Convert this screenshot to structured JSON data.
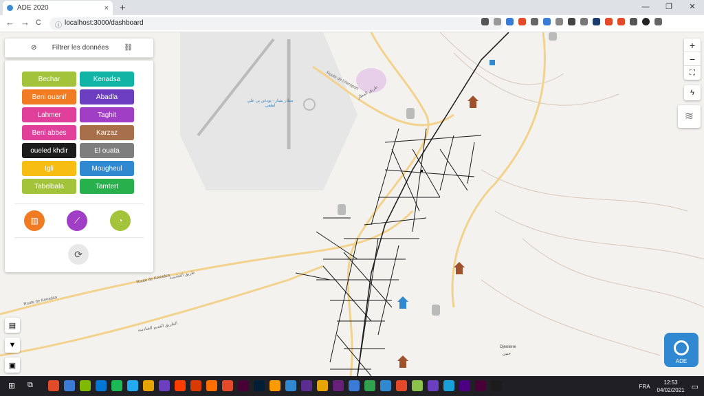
{
  "browser": {
    "tab_title": "ADE 2020",
    "tab_close": "×",
    "new_tab": "+",
    "win_min": "—",
    "win_max": "❐",
    "win_close": "✕",
    "back": "←",
    "forward": "→",
    "reload": "C",
    "url": "localhost:3000/dashboard"
  },
  "panel": {
    "title": "Filtrer les données",
    "cities": [
      {
        "label": "Bechar",
        "color": "#a3c43a"
      },
      {
        "label": "Kenadsa",
        "color": "#12b5a5"
      },
      {
        "label": "Beni ouanif",
        "color": "#f07b22"
      },
      {
        "label": "Abadla",
        "color": "#6b3fc0"
      },
      {
        "label": "Lahmer",
        "color": "#e0409a"
      },
      {
        "label": "Taghit",
        "color": "#a03ec6"
      },
      {
        "label": "Beni abbes",
        "color": "#e0409a"
      },
      {
        "label": "Karzaz",
        "color": "#a8704a"
      },
      {
        "label": "oueled khdir",
        "color": "#1c1c1c"
      },
      {
        "label": "El ouata",
        "color": "#7e7e7e"
      },
      {
        "label": "Igli",
        "color": "#f7bd13"
      },
      {
        "label": "Mougheul",
        "color": "#2f88d0"
      },
      {
        "label": "Tabelbala",
        "color": "#a3c43a"
      },
      {
        "label": "Tamtert",
        "color": "#27b04b"
      }
    ],
    "actions": [
      {
        "name": "bar-chart-icon",
        "color": "#f07b22",
        "glyph": "▥"
      },
      {
        "name": "line-chart-icon",
        "color": "#a03ec6",
        "glyph": "⟋"
      },
      {
        "name": "pie-chart-icon",
        "color": "#a3c43a",
        "glyph": "◔"
      }
    ],
    "refresh_glyph": "⟳"
  },
  "map": {
    "zoom_in": "+",
    "zoom_out": "−",
    "fullscreen": "⛶",
    "labels": {
      "route_aeroport": "Route de l'Aeroport",
      "route_aeroport_ar": "طريق المطار",
      "airport_ar": "مطار بشار - بودغن بن علي لطفي",
      "route_kenadsa": "Route de Kenadsa",
      "route_kenadsa_ar": "طريق القنادسة",
      "route_kenadsa2": "Route de Kenadsa",
      "old_road_ar": "الطريق القديم للقنادسة",
      "djeniene": "Djeniene",
      "djeniene_ar": "جنين"
    }
  },
  "logo_text": "ADE",
  "taskbar": {
    "lang": "FRA",
    "time": "12:53",
    "date": "04/02/2021",
    "icon_colors": [
      "#e24a2a",
      "#3a7bd5",
      "#7fba00",
      "#0078d4",
      "#1db954",
      "#23a9f2",
      "#e8a400",
      "#6b3fc0",
      "#ff3d00",
      "#d83b01",
      "#ff6f00",
      "#e24a2a",
      "#470137",
      "#001e36",
      "#ff9a00",
      "#2f88d0",
      "#5c2d91",
      "#e8a400",
      "#68217a",
      "#3a7bd5",
      "#30a14e",
      "#2f88d0",
      "#e24a2a",
      "#8bc34a",
      "#6b3fc0",
      "#19a0d9",
      "#4b0082",
      "#470137",
      "#1c1c1c"
    ]
  }
}
